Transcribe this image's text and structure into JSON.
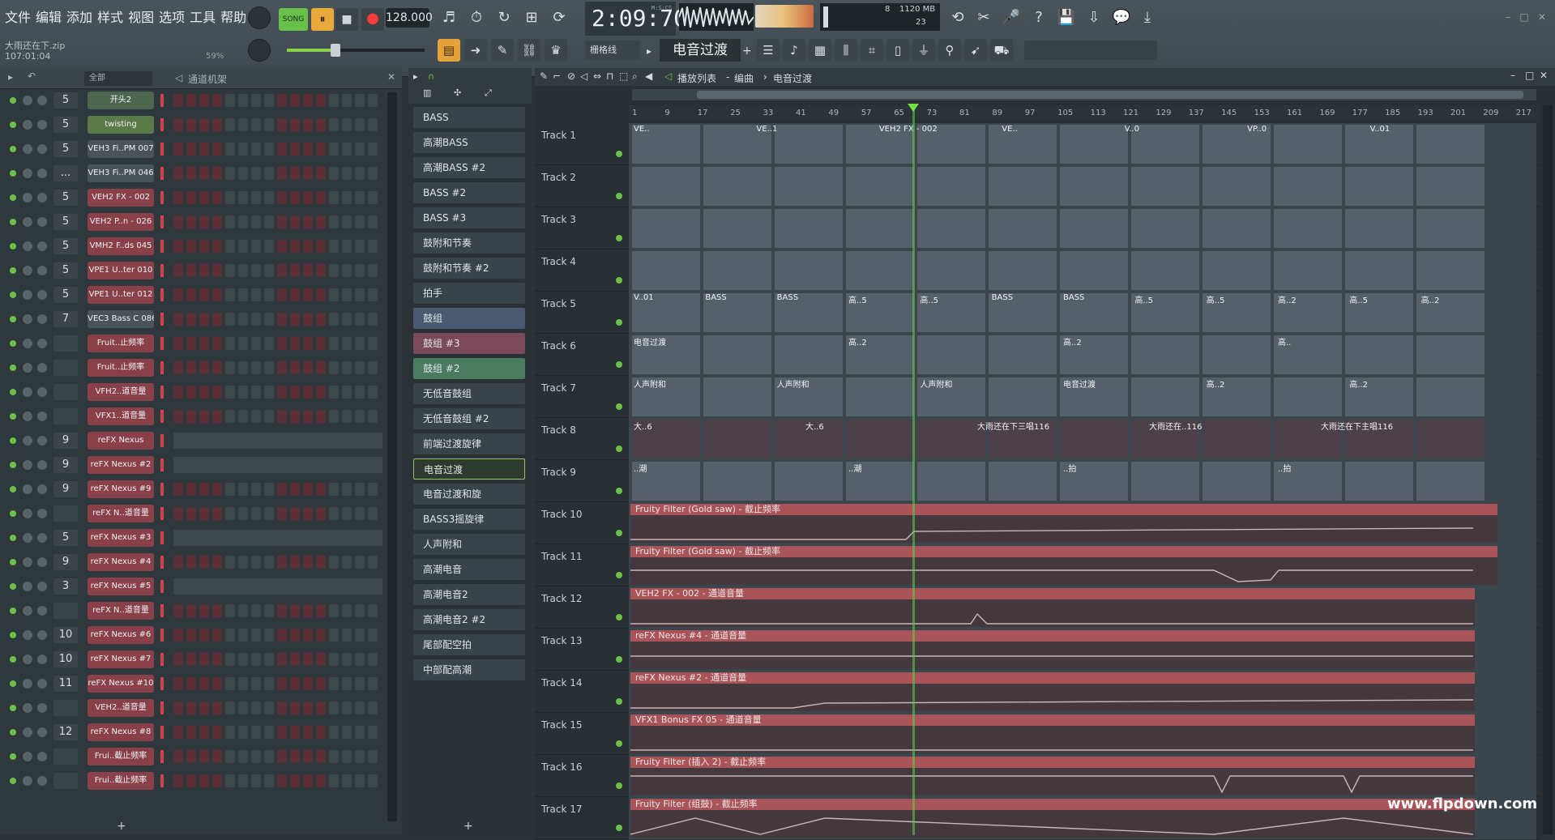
{
  "menu": [
    "文件",
    "编辑",
    "添加",
    "样式",
    "视图",
    "选项",
    "工具",
    "帮助"
  ],
  "song": {
    "file": "大雨还在下.zip",
    "time": "107:01:04",
    "pct": "59%"
  },
  "transport": {
    "song_label": "SONG",
    "play": "⏸",
    "stop": "■",
    "rec": "●",
    "tempo": "128.000"
  },
  "time": {
    "value": "2:09:70",
    "unit": "M:S:CS"
  },
  "cpu": {
    "voices": "8",
    "ram": "1120 MB",
    "poly": "23"
  },
  "toolbar2": {
    "snap": "栅格线",
    "pattern": "电音过渡"
  },
  "rack": {
    "filter": "全部",
    "title": "通道机架",
    "add": "+",
    "channels": [
      {
        "num": "5",
        "name": "开头2",
        "color": "#4d6650",
        "type": "steps"
      },
      {
        "num": "5",
        "name": "twisting",
        "color": "#5b7a4a",
        "type": "steps"
      },
      {
        "num": "5",
        "name": "VEH3 Fi..PM 007",
        "color": "#4a5358",
        "type": "steps"
      },
      {
        "num": "...",
        "name": "VEH3 Fi..PM 046",
        "color": "#4a5358",
        "type": "steps"
      },
      {
        "num": "5",
        "name": "VEH2 FX - 002",
        "color": "#8a4048",
        "type": "steps"
      },
      {
        "num": "5",
        "name": "VEH2 P..n - 026",
        "color": "#8a4048",
        "type": "steps"
      },
      {
        "num": "5",
        "name": "VMH2 F..ds 045",
        "color": "#8a4048",
        "type": "steps"
      },
      {
        "num": "5",
        "name": "VPE1 U..ter 010",
        "color": "#8a4048",
        "type": "steps"
      },
      {
        "num": "5",
        "name": "VPE1 U..ter 012",
        "color": "#8a4048",
        "type": "steps"
      },
      {
        "num": "7",
        "name": "VEC3 Bass C 086",
        "color": "#4a5358",
        "type": "steps"
      },
      {
        "num": "",
        "name": "Fruit..止频率",
        "color": "#8a4048",
        "type": "steps"
      },
      {
        "num": "",
        "name": "Fruit..止频率",
        "color": "#8a4048",
        "type": "steps"
      },
      {
        "num": "",
        "name": "VFH2..道音量",
        "color": "#8a4048",
        "type": "steps"
      },
      {
        "num": "",
        "name": "VFX1..道音量",
        "color": "#8a4048",
        "type": "steps"
      },
      {
        "num": "9",
        "name": "reFX Nexus",
        "color": "#8a4048",
        "type": "seq"
      },
      {
        "num": "9",
        "name": "reFX Nexus #2",
        "color": "#8a4048",
        "type": "seq"
      },
      {
        "num": "9",
        "name": "reFX Nexus #9",
        "color": "#8a4048",
        "type": "steps"
      },
      {
        "num": "",
        "name": "reFX N..道音量",
        "color": "#8a4048",
        "type": "steps"
      },
      {
        "num": "5",
        "name": "reFX Nexus #3",
        "color": "#8a4048",
        "type": "seq"
      },
      {
        "num": "9",
        "name": "reFX Nexus #4",
        "color": "#8a4048",
        "type": "steps"
      },
      {
        "num": "3",
        "name": "reFX Nexus #5",
        "color": "#8a4048",
        "type": "seq"
      },
      {
        "num": "",
        "name": "reFX N..道音量",
        "color": "#8a4048",
        "type": "steps"
      },
      {
        "num": "10",
        "name": "reFX Nexus #6",
        "color": "#8a4048",
        "type": "steps"
      },
      {
        "num": "10",
        "name": "reFX Nexus #7",
        "color": "#8a4048",
        "type": "steps"
      },
      {
        "num": "11",
        "name": "reFX Nexus #10",
        "color": "#8a4048",
        "type": "steps"
      },
      {
        "num": "",
        "name": "VEH2..道音量",
        "color": "#8a4048",
        "type": "steps"
      },
      {
        "num": "12",
        "name": "reFX Nexus #8",
        "color": "#8a4048",
        "type": "steps"
      },
      {
        "num": "",
        "name": "Frui..截止频率",
        "color": "#8a4048",
        "type": "steps"
      },
      {
        "num": "",
        "name": "Frui..截止频率",
        "color": "#8a4048",
        "type": "steps"
      }
    ]
  },
  "picker": {
    "add": "+",
    "patterns": [
      "BASS",
      "高潮BASS",
      "高潮BASS #2",
      "BASS #2",
      "BASS #3",
      "鼓附和节奏",
      "鼓附和节奏 #2",
      "拍手",
      "鼓组",
      "鼓组 #3",
      "鼓组 #2",
      "无低音鼓组",
      "无低音鼓组 #2",
      "前端过渡旋律",
      "电音过渡",
      "电音过渡和旋",
      "BASS3摇旋律",
      "人声附和",
      "高潮电音",
      "高潮电音2",
      "高潮电音2 #2",
      "尾部配空拍",
      "中部配高潮"
    ],
    "selected": "电音过渡"
  },
  "playlist": {
    "crumbs": [
      "播放列表",
      "编曲",
      "电音过渡"
    ],
    "ruler": [
      "1",
      "9",
      "17",
      "25",
      "33",
      "41",
      "49",
      "57",
      "65",
      "73",
      "81",
      "89",
      "97",
      "105",
      "113",
      "121",
      "129",
      "137",
      "145",
      "153",
      "161",
      "169",
      "177",
      "185",
      "193",
      "201",
      "209",
      "217"
    ],
    "tracks": [
      "Track 1",
      "Track 2",
      "Track 3",
      "Track 4",
      "Track 5",
      "Track 6",
      "Track 7",
      "Track 8",
      "Track 9",
      "Track 10",
      "Track 11",
      "Track 12",
      "Track 13",
      "Track 14",
      "Track 15",
      "Track 16",
      "Track 17"
    ],
    "clip_labels": {
      "t1": [
        "VE..",
        "VE..1",
        "VEH2 FX - 002",
        "VE..",
        "V..0",
        "VP..0",
        "V..01"
      ],
      "t5": [
        "V..01",
        "BASS",
        "BASS",
        "高..5",
        "高..5",
        "BASS",
        "BASS",
        "高..5",
        "高..5",
        "高..2",
        "高..5",
        "高..2"
      ],
      "t6": [
        "电音过渡",
        "高..2",
        "高..2",
        "高.."
      ],
      "t7": [
        "人声附和",
        "人声附和",
        "人声附和",
        "电音过渡",
        "高..2",
        "高..2"
      ],
      "t8": [
        "大..6",
        "大..6",
        "大雨还在下三唱116",
        "大雨还在..116",
        "大雨还在下主唱116"
      ],
      "t9": [
        "..潮",
        "..潮",
        "..拍",
        "..拍"
      ],
      "auto": [
        "Fruity Filter (Gold saw) - 截止频率",
        "Fruity Filter (Gold saw) - 截止频率",
        "VEH2 FX - 002 - 通道音量",
        "reFX Nexus #4 - 通道音量",
        "reFX Nexus #2 - 通道音量",
        "VFX1 Bonus FX 05 - 通道音量",
        "Fruity Filter (插入 2) - 截止频率",
        "Fruity Filter (组鼓) - 截止频率"
      ]
    }
  },
  "watermark": "www.flpdown.com",
  "colors": {
    "accent": "#e6a93a",
    "song": "#66c04a",
    "rec": "#ff3b3b",
    "automation": "#a95458",
    "channel": "#8a4048",
    "playhead": "#5bd14a"
  }
}
